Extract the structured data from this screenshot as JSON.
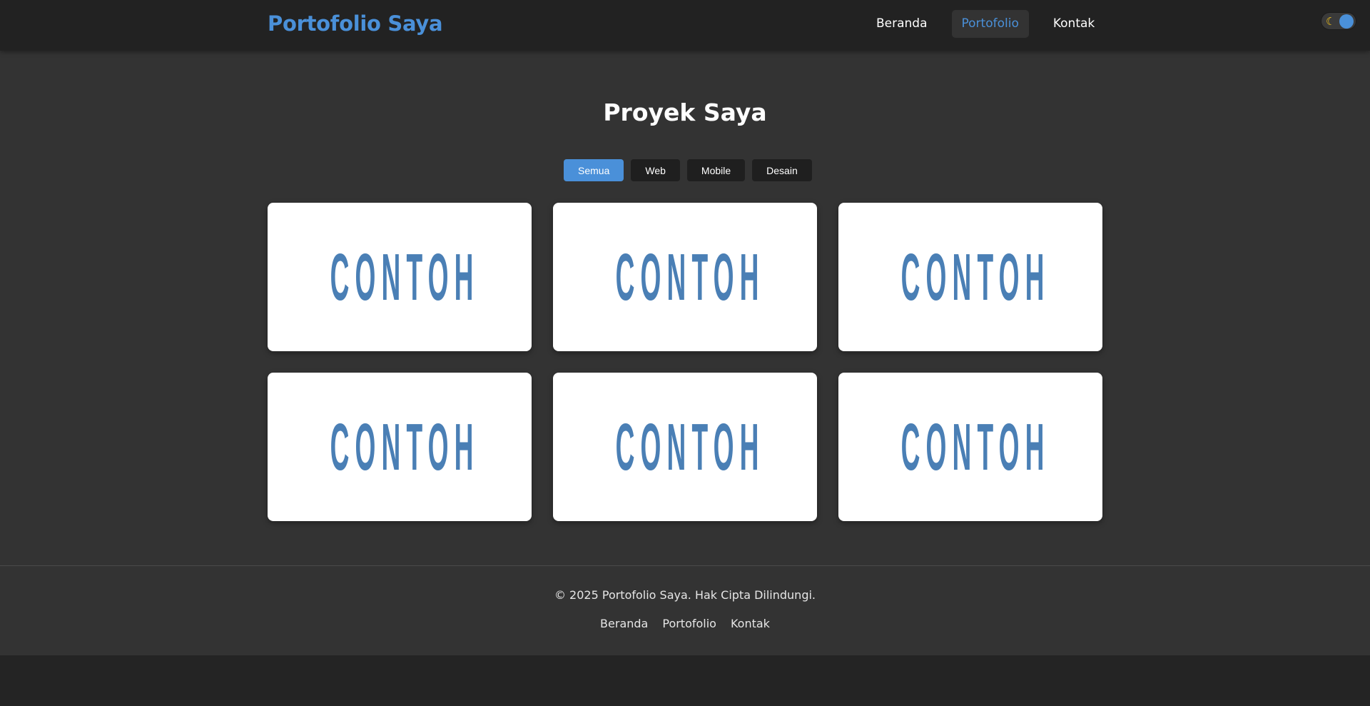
{
  "brand": {
    "title": "Portofolio Saya"
  },
  "nav": {
    "items": [
      {
        "label": "Beranda",
        "active": false
      },
      {
        "label": "Portofolio",
        "active": true
      },
      {
        "label": "Kontak",
        "active": false
      }
    ]
  },
  "theme_toggle": {
    "icon": "moon-icon",
    "state": "dark"
  },
  "main": {
    "title": "Proyek Saya",
    "filters": [
      {
        "label": "Semua",
        "active": true
      },
      {
        "label": "Web",
        "active": false
      },
      {
        "label": "Mobile",
        "active": false
      },
      {
        "label": "Desain",
        "active": false
      }
    ],
    "cards": [
      {
        "label": "CONTOH"
      },
      {
        "label": "CONTOH"
      },
      {
        "label": "CONTOH"
      },
      {
        "label": "CONTOH"
      },
      {
        "label": "CONTOH"
      },
      {
        "label": "CONTOH"
      }
    ]
  },
  "footer": {
    "copyright": "© 2025 Portofolio Saya. Hak Cipta Dilindungi.",
    "links": [
      {
        "label": "Beranda"
      },
      {
        "label": "Portofolio"
      },
      {
        "label": "Kontak"
      }
    ]
  },
  "colors": {
    "accent": "#4a90d9",
    "background": "#333333",
    "header": "#222222",
    "card_text": "#4a7fb5"
  }
}
